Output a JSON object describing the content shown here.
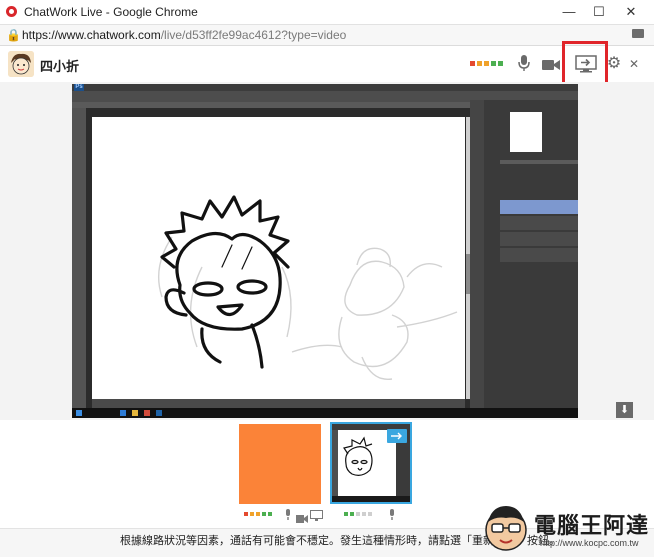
{
  "window": {
    "title": "ChatWork Live - Google Chrome",
    "minimize": "—",
    "maximize": "☐",
    "close": "✕"
  },
  "address": {
    "host": "https://www.chatwork.com",
    "path": "/live/d53ff2fe99ac4612?type=video"
  },
  "header": {
    "username": "四小折",
    "signal_colors": [
      "#e44a2f",
      "#f0a22a",
      "#f0a22a",
      "#4caf50",
      "#4caf50"
    ],
    "icons": [
      "microphone-icon",
      "video-camera-icon",
      "screen-share-icon",
      "gear-icon",
      "close-icon"
    ],
    "close_glyph": "✕",
    "gear_glyph": "⚙"
  },
  "participants": {
    "tile1_signal": [
      "#e44a2f",
      "#f0a22a",
      "#f0a22a",
      "#4caf50",
      "#4caf50"
    ],
    "tile2_signal": [
      "#4caf50",
      "#4caf50",
      "#cfcfcf",
      "#cfcfcf",
      "#cfcfcf"
    ]
  },
  "footer": {
    "notice": "根據線路狀況等因素，通話有可能會不穩定。發生這種情形時，請點選「重新整理」按鈕。"
  },
  "watermark": {
    "title": "電腦王阿達",
    "url": "http://www.kocpc.com.tw"
  },
  "colors": {
    "highlight": "#e0252a",
    "self_tile": "#fb8338",
    "selected_border": "#3aa7e0"
  }
}
